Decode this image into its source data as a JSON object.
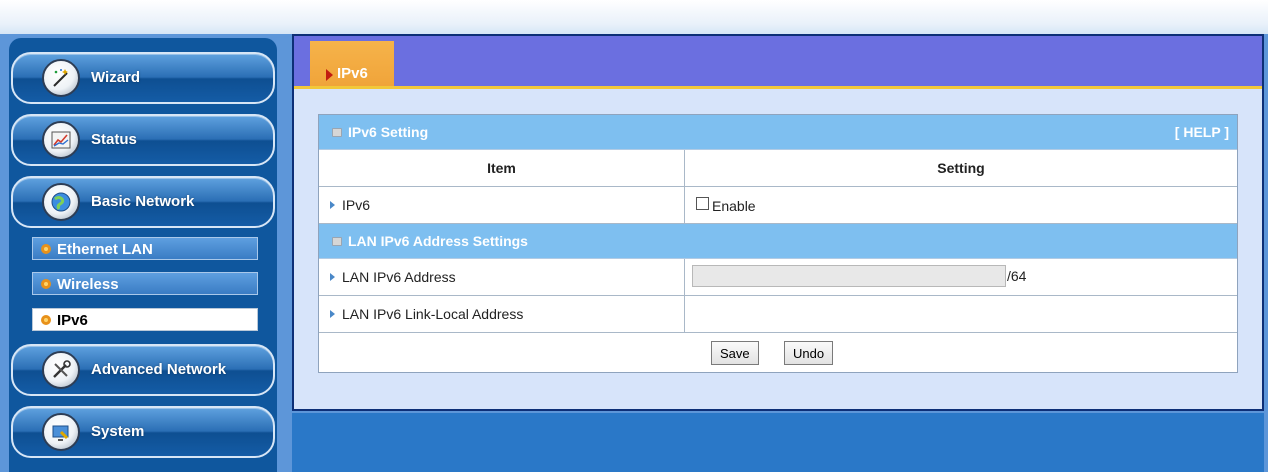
{
  "sidebar": {
    "items": [
      {
        "label": "Wizard",
        "icon": "wizard-wand-icon"
      },
      {
        "label": "Status",
        "icon": "status-chart-icon"
      },
      {
        "label": "Basic Network",
        "icon": "globe-icon"
      },
      {
        "label": "Advanced Network",
        "icon": "tools-icon"
      },
      {
        "label": "System",
        "icon": "system-icon"
      }
    ],
    "sub_items": [
      {
        "label": "Ethernet LAN",
        "active": false
      },
      {
        "label": "Wireless",
        "active": false
      },
      {
        "label": "IPv6",
        "active": true
      }
    ]
  },
  "page": {
    "tab_label": "IPv6"
  },
  "table": {
    "section1": {
      "title": "IPv6 Setting",
      "help": "[ HELP ]"
    },
    "header": {
      "item": "Item",
      "setting": "Setting"
    },
    "ipv6_row": {
      "label": "IPv6",
      "checkbox_label": "Enable",
      "checked": false
    },
    "section2": {
      "title": "LAN IPv6 Address Settings"
    },
    "lan_addr_row": {
      "label": "LAN IPv6 Address",
      "value": "",
      "suffix": "/64"
    },
    "link_local_row": {
      "label": "LAN IPv6 Link-Local Address",
      "value": ""
    },
    "buttons": {
      "save": "Save",
      "undo": "Undo"
    }
  },
  "colors": {
    "header_bar": "#6b6fe0",
    "tab": "#f0a43a",
    "section_row": "#7ebff0",
    "sidebar": "#0f579e"
  }
}
